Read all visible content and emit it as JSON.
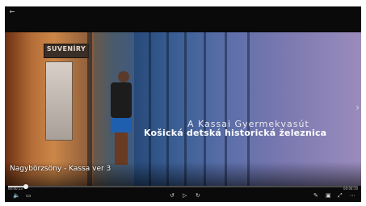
{
  "window": {
    "back_glyph": "←"
  },
  "video": {
    "shop_sign": "SUVENÍRY",
    "caption_line1": "A Kassai Gyermekvasút",
    "caption_line2": "Košická detská historická železnica",
    "caption_line3": "Nagybörzsöny - Kassa ver 3",
    "next_glyph": "›"
  },
  "controls": {
    "time_elapsed": "00:00:13",
    "time_total": "00:04:10",
    "progress_fraction": 0.05,
    "icons": {
      "volume": "🔈",
      "subtitles": "▭",
      "rewind": "↺",
      "play": "▷",
      "forward": "↻",
      "edit": "✎",
      "miniview": "▣",
      "fullscreen": "⤢",
      "more": "⋯"
    }
  }
}
